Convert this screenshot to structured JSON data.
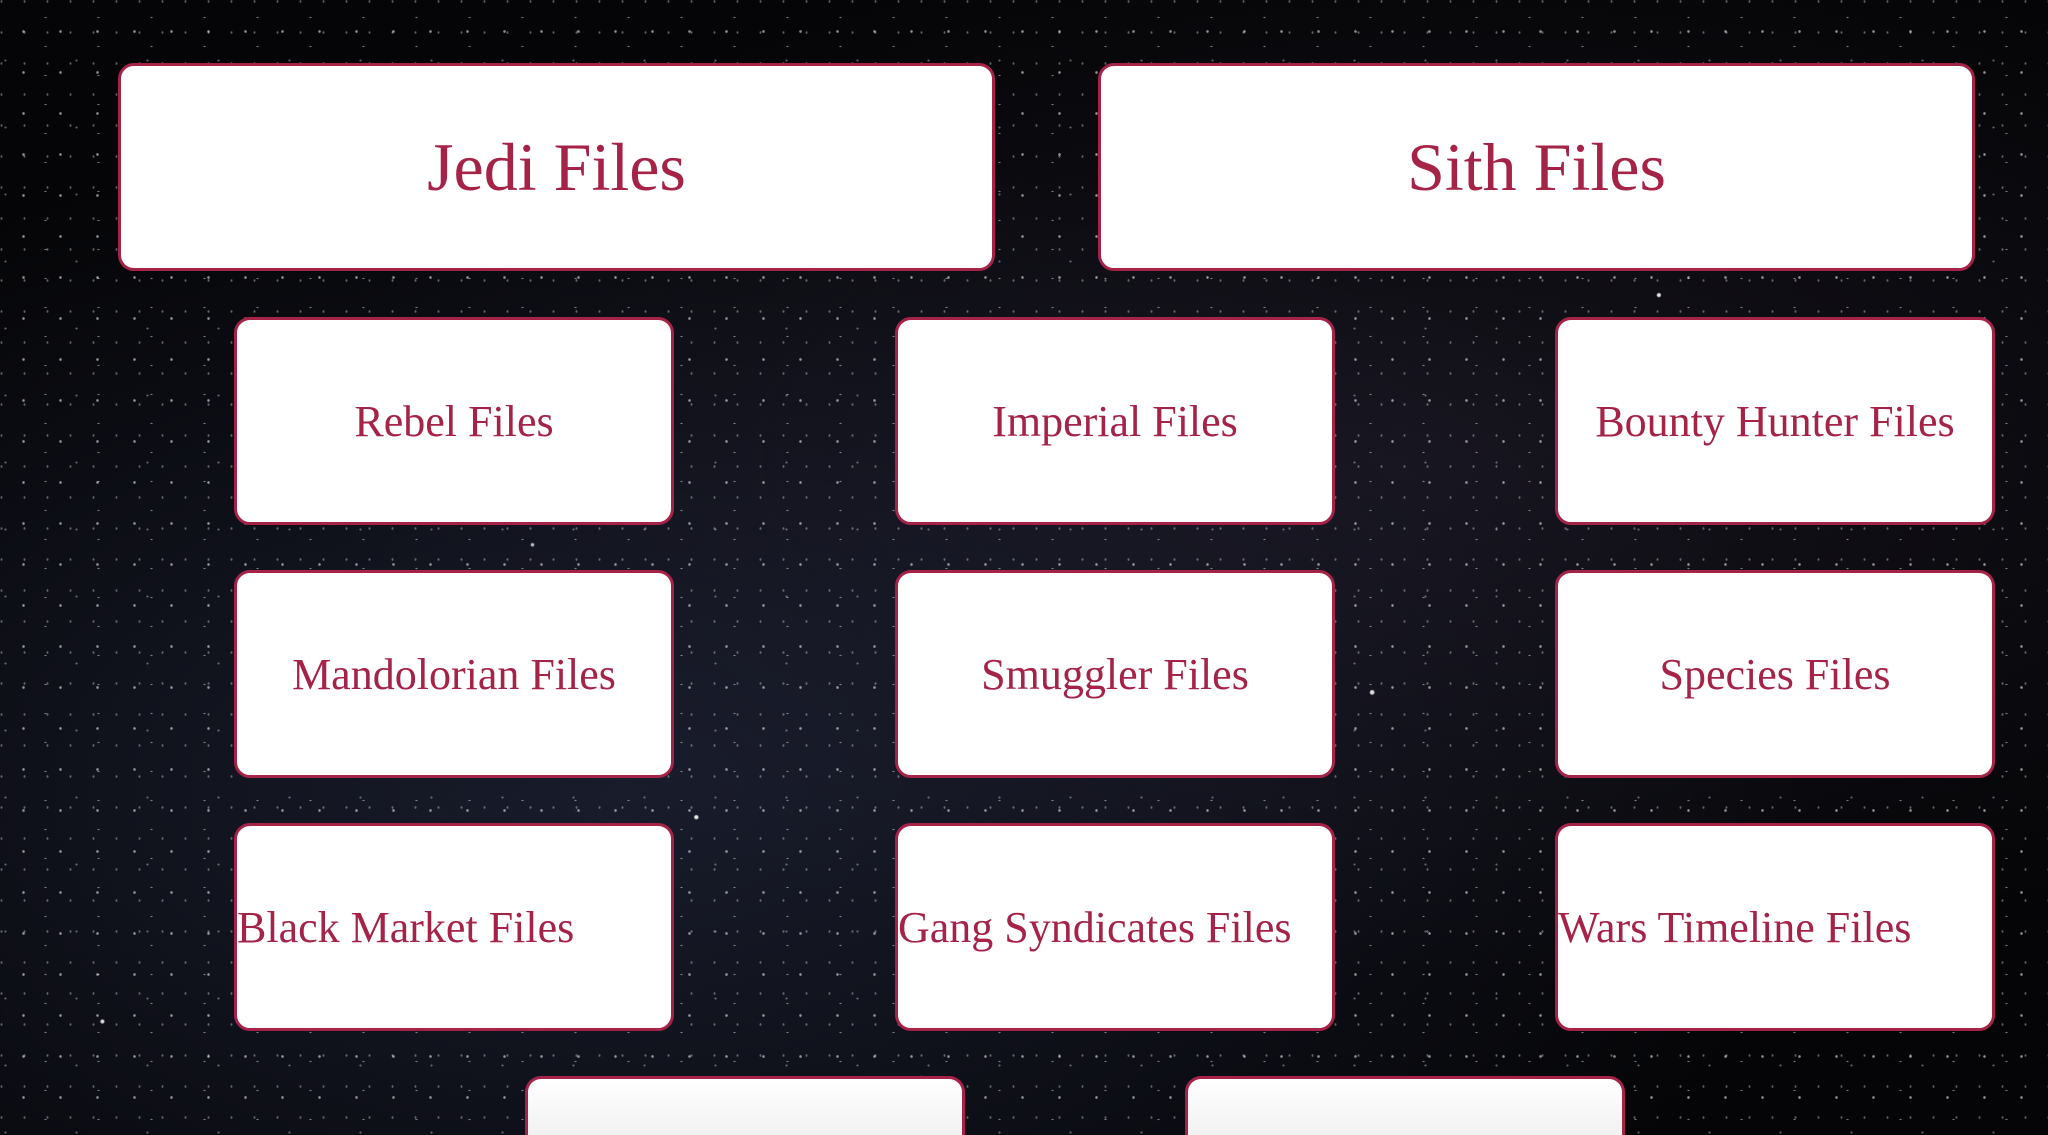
{
  "main_categories": [
    {
      "label": "Jedi Files"
    },
    {
      "label": "Sith Files"
    }
  ],
  "categories": [
    {
      "label": "Rebel Files"
    },
    {
      "label": "Imperial Files"
    },
    {
      "label": "Bounty Hunter Files"
    },
    {
      "label": "Mandolorian Files"
    },
    {
      "label": "Smuggler Files"
    },
    {
      "label": "Species Files"
    },
    {
      "label": "Black Market Files"
    },
    {
      "label": "Gang Syndicates Files"
    },
    {
      "label": "Wars Timeline Files"
    }
  ],
  "colors": {
    "accent": "#a62348",
    "card_background": "#ffffff",
    "page_background": "#050507"
  }
}
